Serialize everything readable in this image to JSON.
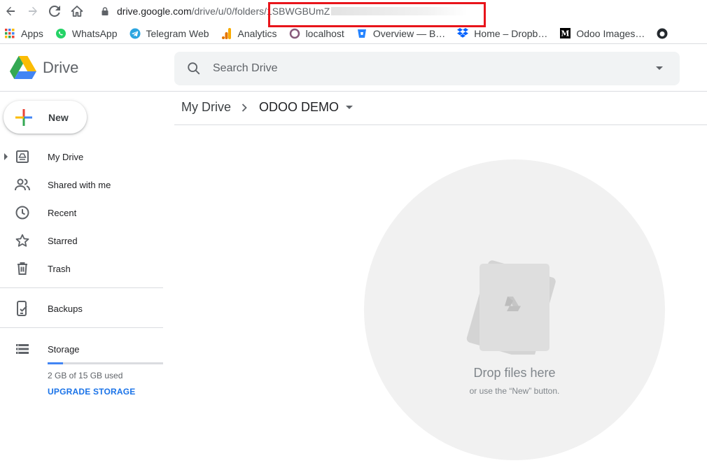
{
  "browser": {
    "url_host": "drive.google.com",
    "url_path": "/drive/u/0/folders/",
    "url_id_visible": "1SBWGBUmZ"
  },
  "bookmarks": [
    {
      "label": "Apps",
      "icon": "apps-grid-icon"
    },
    {
      "label": "WhatsApp",
      "icon": "whatsapp-icon"
    },
    {
      "label": "Telegram Web",
      "icon": "telegram-icon"
    },
    {
      "label": "Analytics",
      "icon": "analytics-icon"
    },
    {
      "label": "localhost",
      "icon": "localhost-icon"
    },
    {
      "label": "Overview — B…",
      "icon": "bitbucket-icon"
    },
    {
      "label": "Home – Dropb…",
      "icon": "dropbox-icon"
    },
    {
      "label": "Odoo Images…",
      "icon": "medium-icon"
    }
  ],
  "drive": {
    "logo_text": "Drive",
    "search_placeholder": "Search Drive"
  },
  "sidebar": {
    "new_label": "New",
    "items": [
      {
        "label": "My Drive",
        "icon": "my-drive-icon"
      },
      {
        "label": "Shared with me",
        "icon": "shared-icon"
      },
      {
        "label": "Recent",
        "icon": "clock-icon"
      },
      {
        "label": "Starred",
        "icon": "star-icon"
      },
      {
        "label": "Trash",
        "icon": "trash-icon"
      },
      {
        "label": "Backups",
        "icon": "backups-icon"
      },
      {
        "label": "Storage",
        "icon": "storage-icon"
      }
    ],
    "storage_used_text": "2 GB of 15 GB used",
    "storage_fraction": 0.133,
    "upgrade_label": "UPGRADE STORAGE"
  },
  "breadcrumb": {
    "root": "My Drive",
    "current": "ODOO DEMO"
  },
  "empty_state": {
    "title": "Drop files here",
    "subtitle": "or use the “New” button."
  },
  "colors": {
    "accent_blue": "#1a73e8",
    "highlight_red": "#e8141b",
    "storage_fill": "#4285f4"
  }
}
